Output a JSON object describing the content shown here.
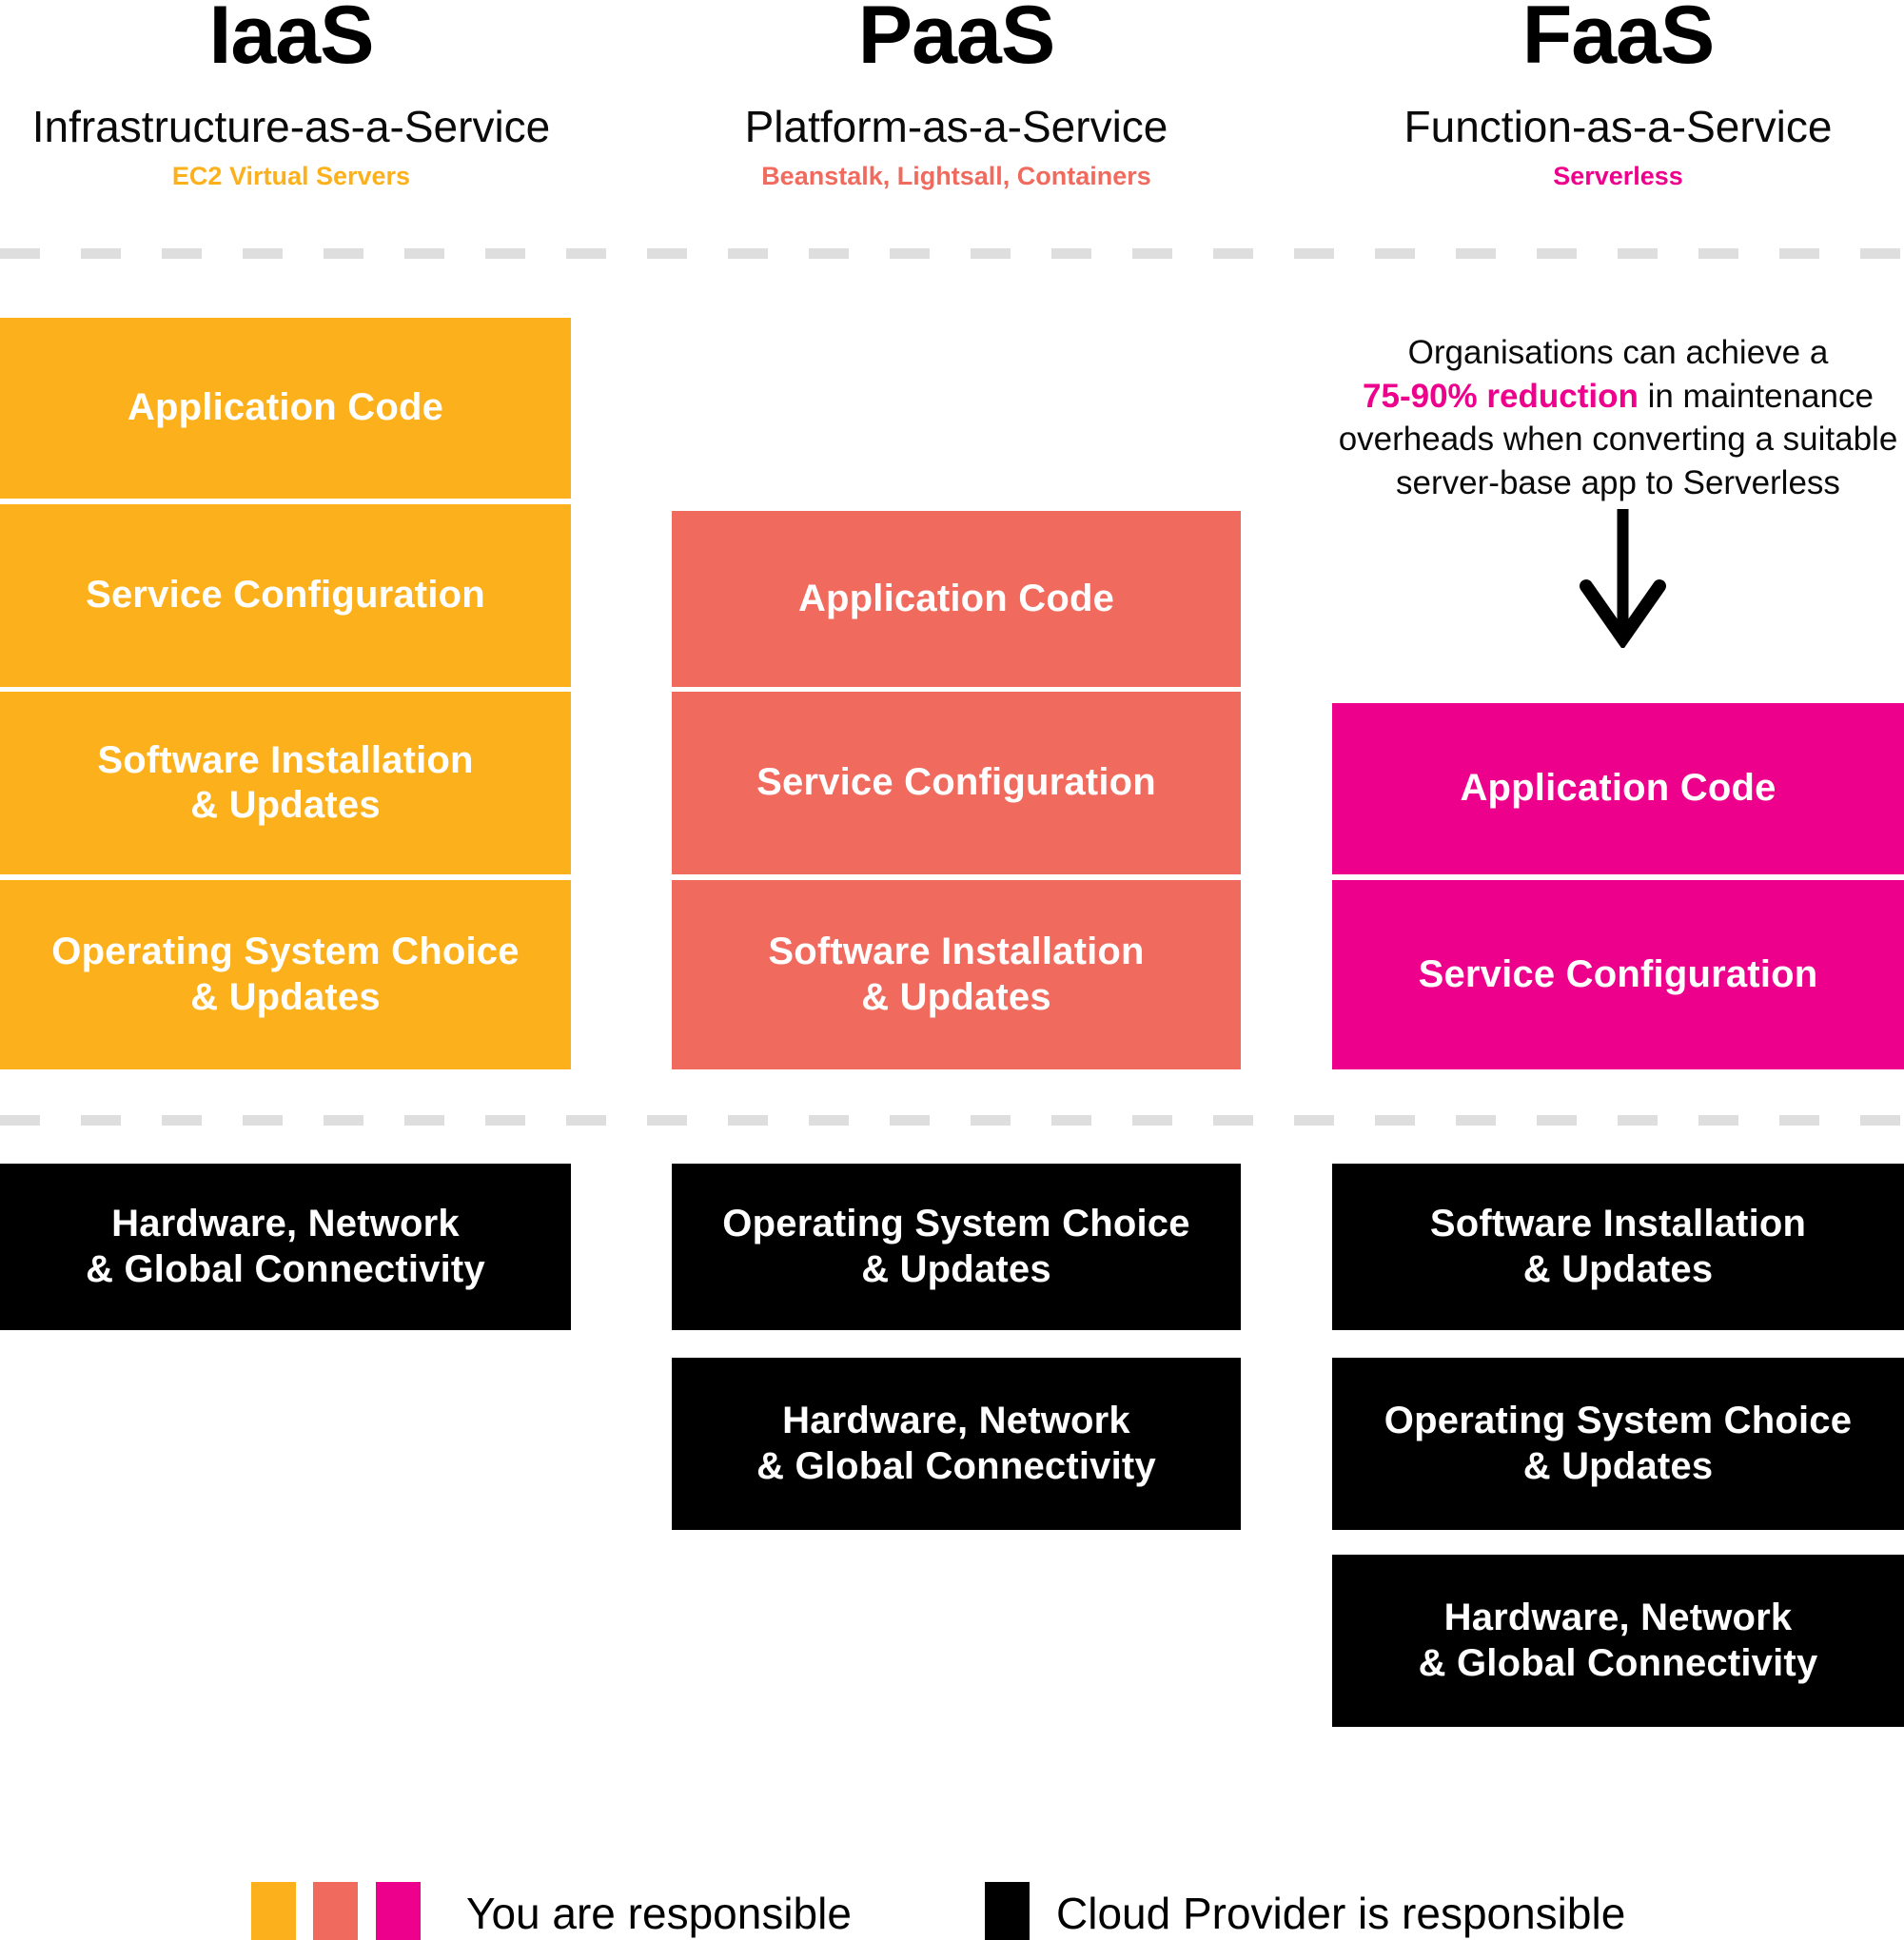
{
  "columns": [
    {
      "id": "iaas",
      "title": "IaaS",
      "subtitle": "Infrastructure-as-a-Service",
      "services": "EC2 Virtual Servers",
      "services_color": "#FCB11C",
      "accent": "#FCB11C",
      "customer_boxes": [
        "Application Code",
        "Service Configuration",
        "Software Installation\n& Updates",
        "Operating System Choice\n& Updates"
      ],
      "provider_boxes": [
        "Hardware, Network\n& Global Connectivity"
      ]
    },
    {
      "id": "paas",
      "title": "PaaS",
      "subtitle": "Platform-as-a-Service",
      "services": "Beanstalk, Lightsall, Containers",
      "services_color": "#F06A5E",
      "accent": "#F06A5E",
      "customer_boxes": [
        "Application Code",
        "Service Configuration",
        "Software Installation\n& Updates"
      ],
      "provider_boxes": [
        "Operating System Choice\n& Updates",
        "Hardware, Network\n& Global Connectivity"
      ]
    },
    {
      "id": "faas",
      "title": "FaaS",
      "subtitle": "Function-as-a-Service",
      "services": "Serverless",
      "services_color": "#ED008C",
      "accent": "#ED008C",
      "customer_boxes": [
        "Application Code",
        "Service Configuration"
      ],
      "provider_boxes": [
        "Software Installation\n& Updates",
        "Operating System Choice\n& Updates",
        "Hardware, Network\n& Global Connectivity"
      ]
    }
  ],
  "callout": {
    "line1": "Organisations can achieve a",
    "highlight": "75-90% reduction",
    "line2_rest": " in maintenance",
    "line3": "overheads when converting a suitable",
    "line4": "server-base app to Serverless",
    "highlight_color": "#ED008C"
  },
  "legend": {
    "customer_label": "You are responsible",
    "provider_label": "Cloud Provider is responsible",
    "customer_swatches": [
      "#FCB11C",
      "#F06A5E",
      "#ED008C"
    ],
    "provider_swatch": "#000000"
  },
  "separator_color": "#DEDEDE"
}
